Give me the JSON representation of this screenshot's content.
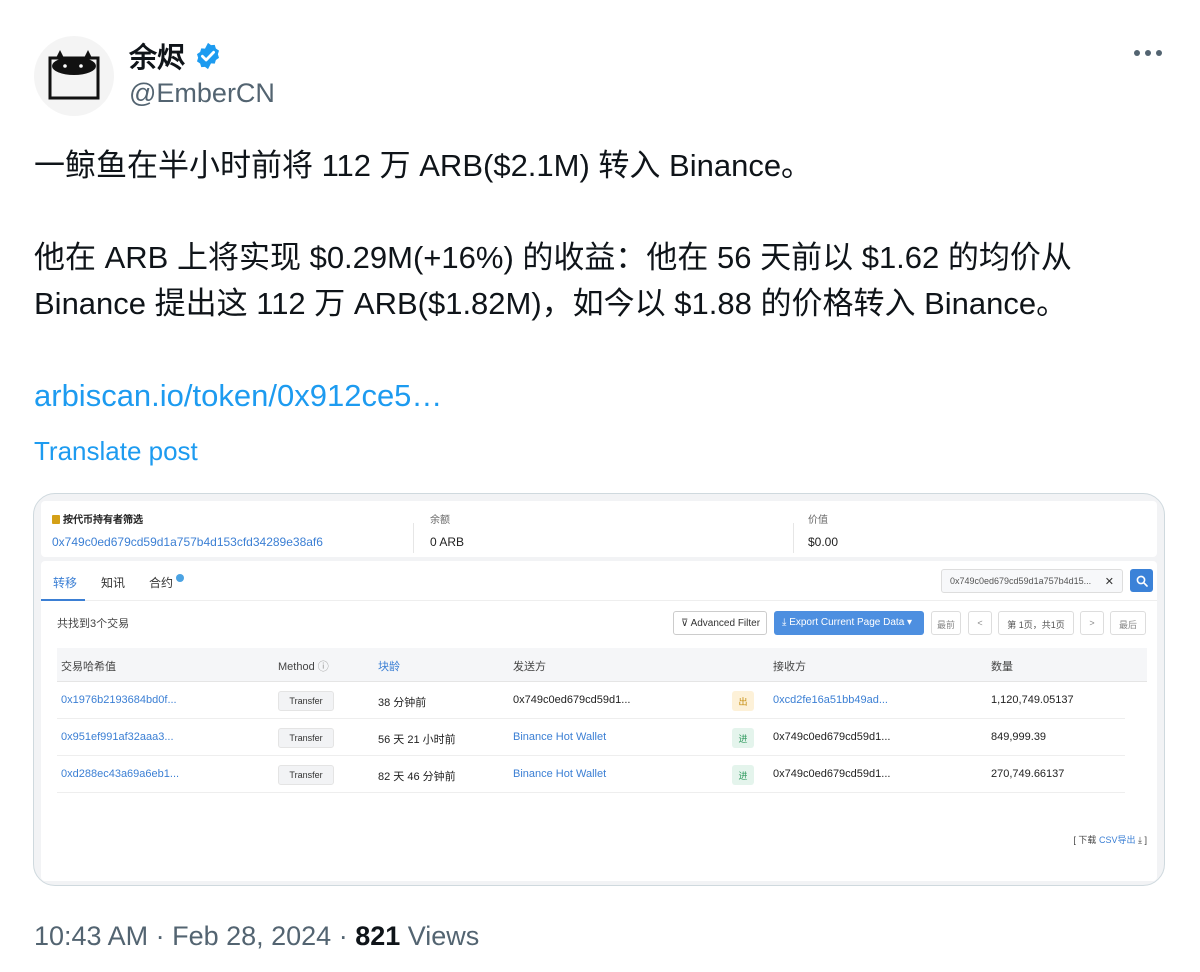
{
  "author": {
    "display_name": "余烬",
    "handle": "@EmberCN"
  },
  "tweet": {
    "line1": "一鲸鱼在半小时前将 112 万 ARB($2.1M) 转入 Binance。",
    "line2": "他在 ARB 上将实现 $0.29M(+16%) 的收益：他在 56 天前以 $1.62 的均价从",
    "line3": "Binance 提出这 112 万 ARB($1.82M)，如今以 $1.88 的价格转入 Binance。",
    "link": "arbiscan.io/token/0x912ce5…",
    "translate": "Translate post"
  },
  "media": {
    "filter_label": "按代币持有者筛选",
    "filter_address": "0x749c0ed679cd59d1a757b4d153cfd34289e38af6",
    "balance_label": "余额",
    "balance_value": "0 ARB",
    "value_label": "价值",
    "value_value": "$0.00",
    "tabs": [
      "转移",
      "知讯",
      "合约"
    ],
    "search_value": "0x749c0ed679cd59d1a757b4d15...",
    "found_text": "共找到3个交易",
    "advanced_filter": "Advanced Filter",
    "export_label": "Export Current Page Data",
    "pager": {
      "first": "最前",
      "prev": "<",
      "page_info": "第 1页，共1页",
      "next": ">",
      "last": "最后"
    },
    "headers": {
      "hash": "交易哈希值",
      "method": "Method",
      "age": "块龄",
      "from": "发送方",
      "to": "接收方",
      "qty": "数量"
    },
    "rows": [
      {
        "hash": "0x1976b2193684bd0f...",
        "method": "Transfer",
        "age": "38 分钟前",
        "from": "0x749c0ed679cd59d1...",
        "dir": "出",
        "to": "0xcd2fe16a51bb49ad...",
        "qty": "1,120,749.05137"
      },
      {
        "hash": "0x951ef991af32aaa3...",
        "method": "Transfer",
        "age": "56 天 21 小时前",
        "from": "Binance Hot Wallet",
        "dir": "进",
        "to": "0x749c0ed679cd59d1...",
        "qty": "849,999.39"
      },
      {
        "hash": "0xd288ec43a69a6eb1...",
        "method": "Transfer",
        "age": "82 天 46 分钟前",
        "from": "Binance Hot Wallet",
        "dir": "进",
        "to": "0x749c0ed679cd59d1...",
        "qty": "270,749.66137"
      }
    ],
    "csv_prefix": "[ 下载",
    "csv_link": "CSV导出",
    "csv_suffix": "]"
  },
  "footer": {
    "time": "10:43 AM · Feb 28, 2024 · ",
    "views_count": "821",
    "views_label": " Views"
  },
  "colors": {
    "link": "#1d9bf0",
    "verified": "#1d9bf0",
    "table_link": "#3b7fd4"
  }
}
